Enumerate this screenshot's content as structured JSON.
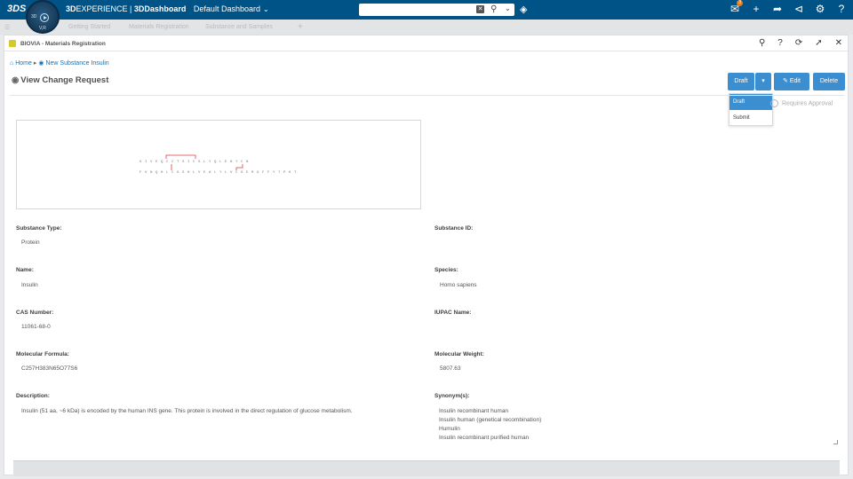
{
  "topbar": {
    "logo": "3DS",
    "compass_labels": [
      "3D",
      "V,R"
    ],
    "brand_prefix": "3D",
    "brand_experience": "EXPERIENCE",
    "brand_app": "3DDashboard",
    "dashboard_name": "Default Dashboard",
    "notification_count": "3"
  },
  "tabs": [
    "Getting Started",
    "Materials Registration",
    "Substance and Samples"
  ],
  "widget": {
    "title": "BIOVIA - Materials Registration"
  },
  "breadcrumb": {
    "home": "Home",
    "current": "New Substance Insulin"
  },
  "page": {
    "title": "View Change Request"
  },
  "actions": {
    "status_label": "Draft",
    "edit_label": "Edit",
    "delete_label": "Delete",
    "menu_items": [
      "Draft",
      "Submit"
    ],
    "requires_approval": "Requires Approval"
  },
  "fields": {
    "substance_type": {
      "label": "Substance Type:",
      "value": "Protein"
    },
    "substance_id": {
      "label": "Substance ID:",
      "value": ""
    },
    "name": {
      "label": "Name:",
      "value": "Insulin"
    },
    "species": {
      "label": "Species:",
      "value": "Homo sapiens"
    },
    "cas_number": {
      "label": "CAS Number:",
      "value": "11061-68-0"
    },
    "iupac_name": {
      "label": "IUPAC Name:",
      "value": ""
    },
    "molecular_formula": {
      "label": "Molecular Formula:",
      "value": "C257H383N65O77S6"
    },
    "molecular_weight": {
      "label": "Molecular Weight:",
      "value": "5807.63"
    },
    "description": {
      "label": "Description:",
      "value": "Insulin (51 aa, ~6 kDa) is encoded by the human INS gene. This protein is involved in the direct regulation of glucose metabolism."
    },
    "synonyms": {
      "label": "Synonym(s):",
      "values": [
        "Insulin recombinant human",
        "Insulin human (genetical recombination)",
        "Humulin",
        "Insulin recombinant purified human"
      ]
    }
  },
  "structure": {
    "chain_a": "GIVEQCCTSICSLYQLENYCN",
    "chain_b": "FVNQHLCGSHLVEALYLVCGERGFFYTPKT",
    "bond_color": "#e0393e"
  },
  "colors": {
    "topbar": "#005386",
    "primary_button": "#3b8fd0",
    "link": "#1f6fa8",
    "badge": "#e87b1e"
  }
}
